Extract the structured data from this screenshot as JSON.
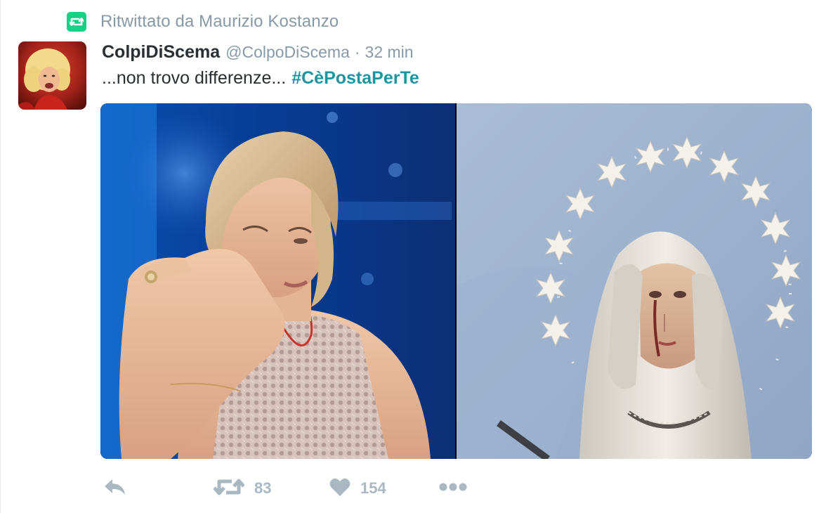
{
  "retweet_context": {
    "icon": "retweet-icon",
    "text": "Ritwittato da Maurizio Kostanzo",
    "badge_color": "#19cf86"
  },
  "tweet": {
    "fullname": "ColpiDiScema",
    "username": "@ColpoDiScema",
    "separator": "·",
    "timestamp": "32 min",
    "text": "...non trovo differenze...",
    "hashtag": "#CèPostaPerTe",
    "hashtag_color": "#1b95a0"
  },
  "media": {
    "photos": [
      "left-photo",
      "right-photo"
    ]
  },
  "actions": {
    "reply": {
      "icon": "reply-icon"
    },
    "retweet": {
      "icon": "retweet-icon",
      "count": "83"
    },
    "like": {
      "icon": "heart-icon",
      "count": "154"
    },
    "more": {
      "icon": "more-icon"
    },
    "icon_color": "#aab8c2"
  }
}
